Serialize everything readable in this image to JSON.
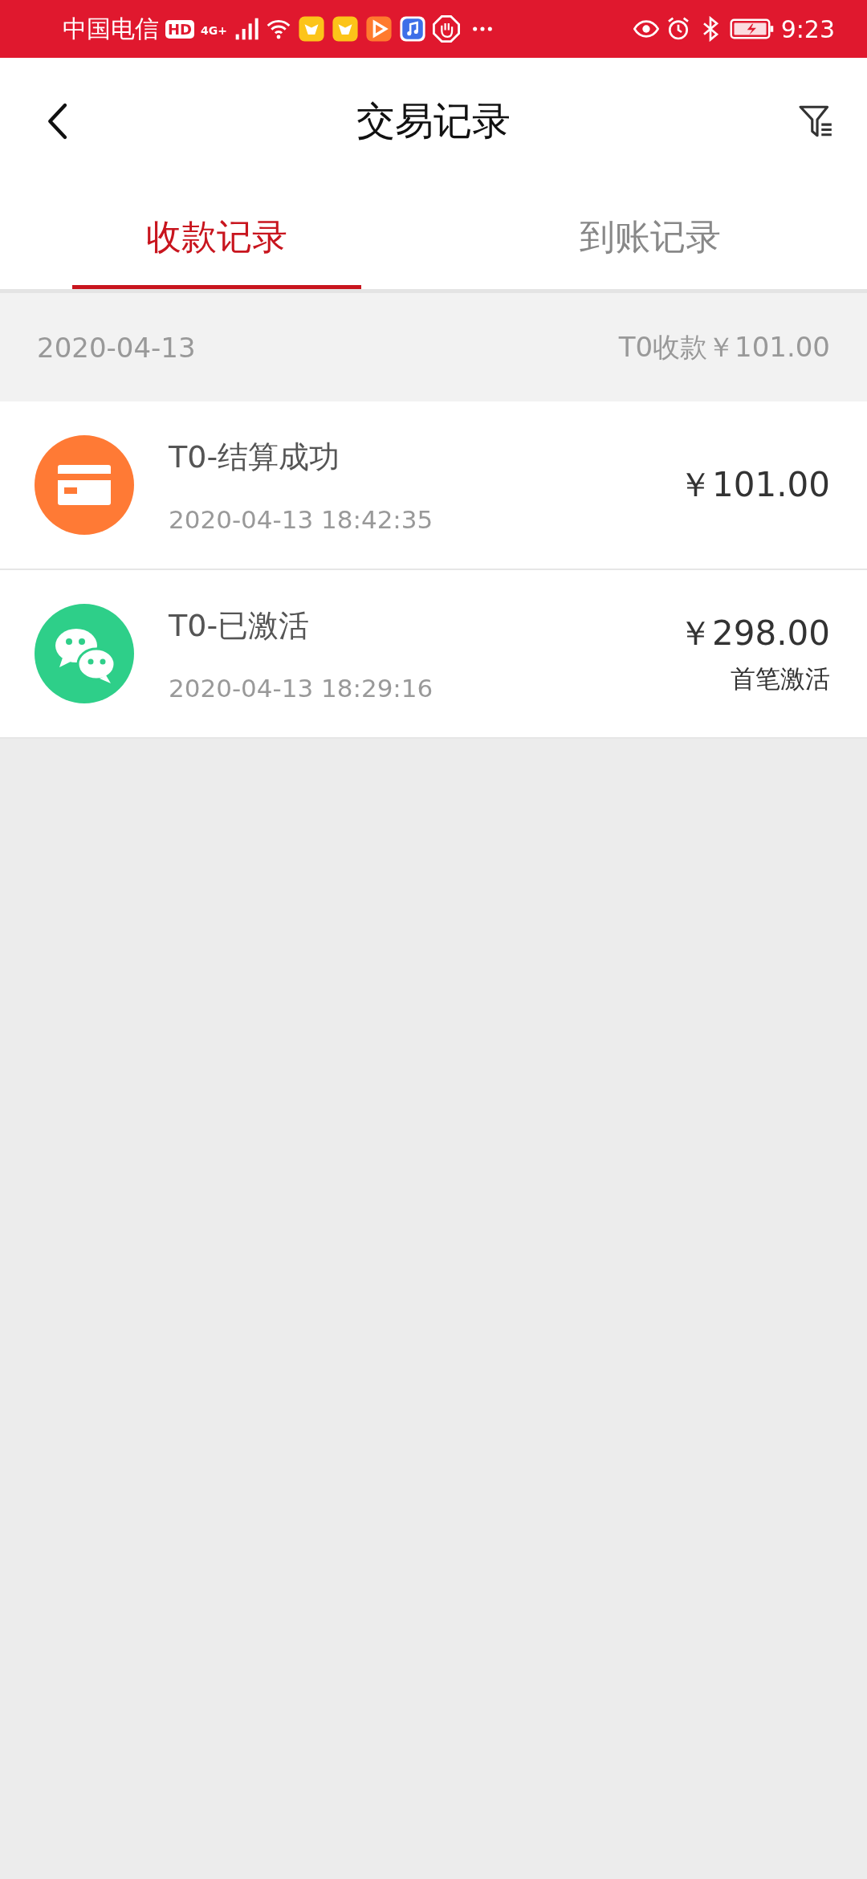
{
  "status_bar": {
    "carrier": "中国电信",
    "hd": "HD",
    "network": "4G+",
    "time": "9:23"
  },
  "header": {
    "title": "交易记录"
  },
  "tabs": [
    {
      "label": "收款记录",
      "selected": true
    },
    {
      "label": "到账记录",
      "selected": false
    }
  ],
  "group": {
    "date": "2020-04-13",
    "summary": "T0收款￥101.00"
  },
  "records": [
    {
      "kind": "card",
      "title": "T0-结算成功",
      "time": "2020-04-13 18:42:35",
      "amount": "￥101.00"
    },
    {
      "kind": "wechat",
      "title": "T0-已激活",
      "time": "2020-04-13 18:29:16",
      "amount": "￥298.00",
      "note": "首笔激活"
    }
  ]
}
